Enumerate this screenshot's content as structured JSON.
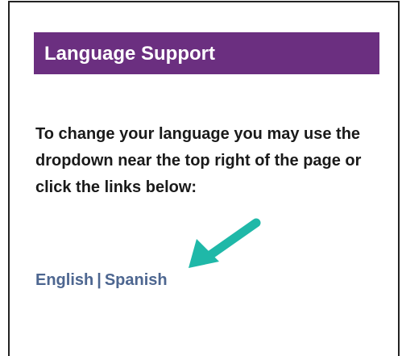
{
  "panel": {
    "title": "Language Support",
    "instructions": "To change your language you may use the dropdown near the top right of the page or click the links below:"
  },
  "links": {
    "english_label": "English",
    "separator": "|",
    "spanish_label": "Spanish"
  },
  "colors": {
    "header_bg": "#6b2f80",
    "link": "#4d6690",
    "arrow": "#1fb8a8"
  },
  "annotation": {
    "icon": "arrow-pointing-down-left-icon"
  }
}
